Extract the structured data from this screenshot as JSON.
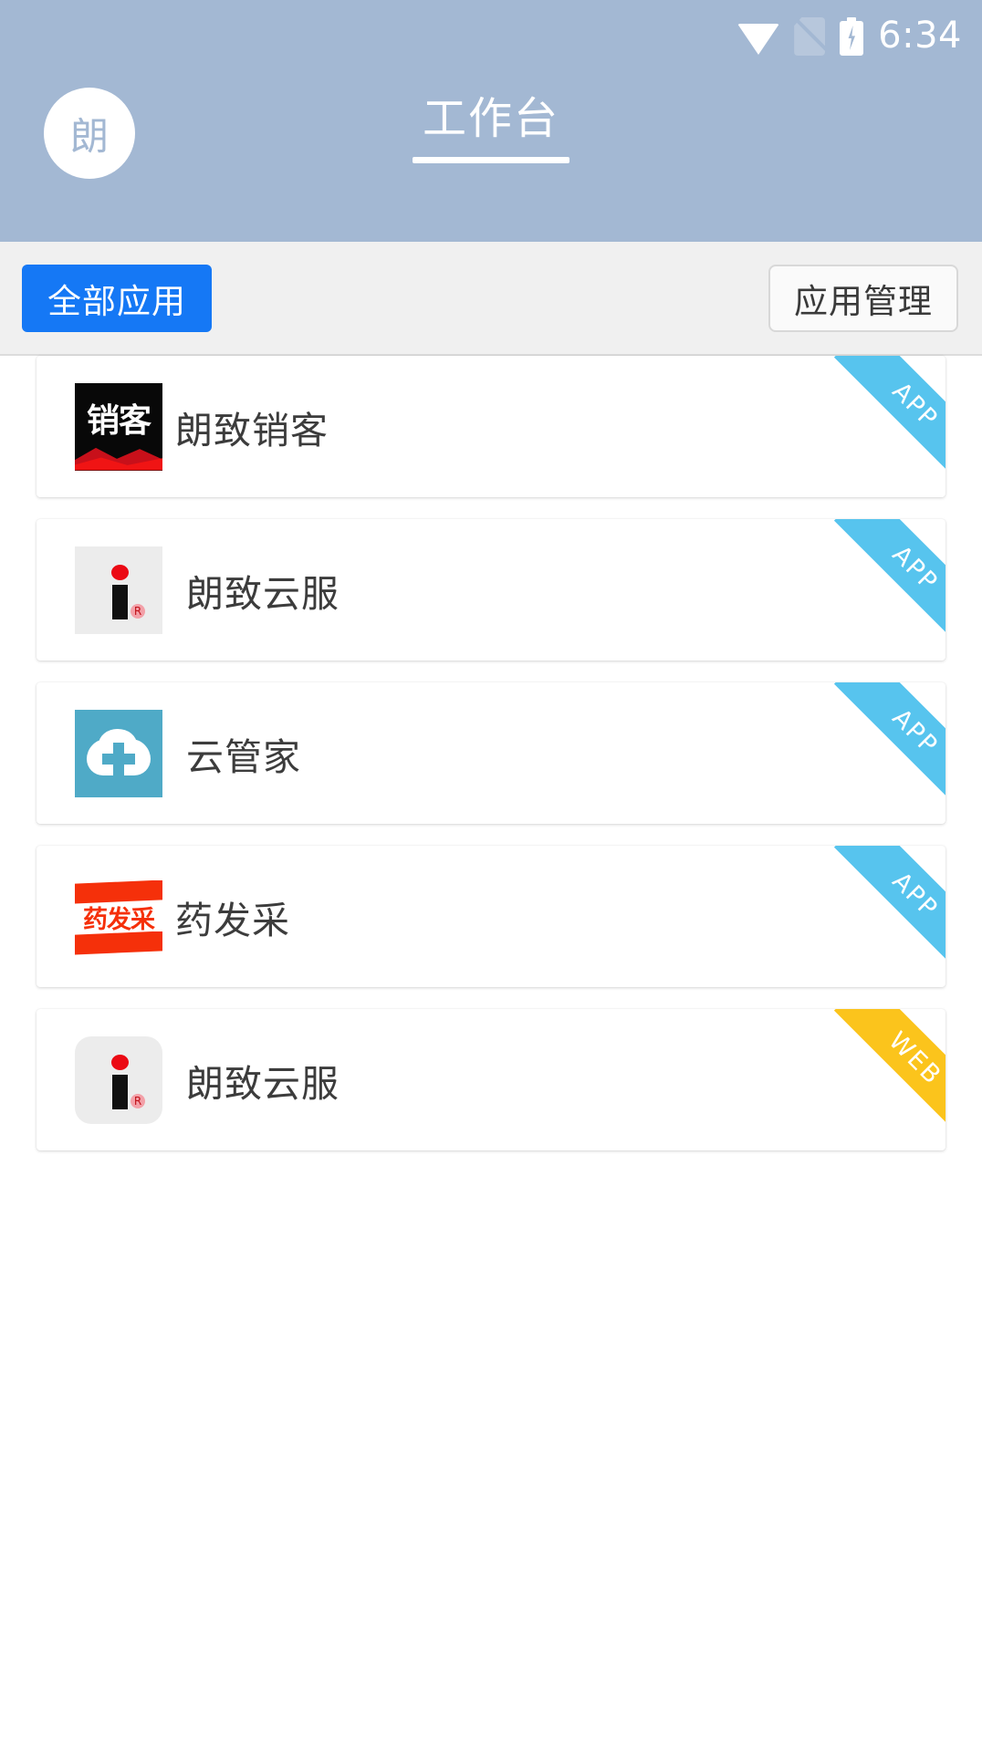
{
  "statusbar": {
    "time": "6:34",
    "icons": [
      "wifi-icon",
      "sim-off-icon",
      "battery-charging-icon"
    ]
  },
  "header": {
    "avatar_initial": "朗",
    "title": "工作台",
    "background_color": "#A3B8D3"
  },
  "filterbar": {
    "all_apps_label": "全部应用",
    "all_apps_color": "#1578F5",
    "manage_label": "应用管理"
  },
  "apps": [
    {
      "name": "朗致销客",
      "icon": "xiaoke-icon",
      "icon_text": "销客",
      "badge": "APP",
      "badge_color": "#57C4EE"
    },
    {
      "name": "朗致云服",
      "icon": "i-logo-icon",
      "badge": "APP",
      "badge_color": "#57C4EE"
    },
    {
      "name": "云管家",
      "icon": "cloud-cross-icon",
      "badge": "APP",
      "badge_color": "#57C4EE"
    },
    {
      "name": "药发采",
      "icon": "yaofacai-icon",
      "icon_text": "药发采",
      "badge": "APP",
      "badge_color": "#57C4EE"
    },
    {
      "name": "朗致云服",
      "icon": "i-logo-icon",
      "badge": "WEB",
      "badge_color": "#FBC41C"
    }
  ]
}
